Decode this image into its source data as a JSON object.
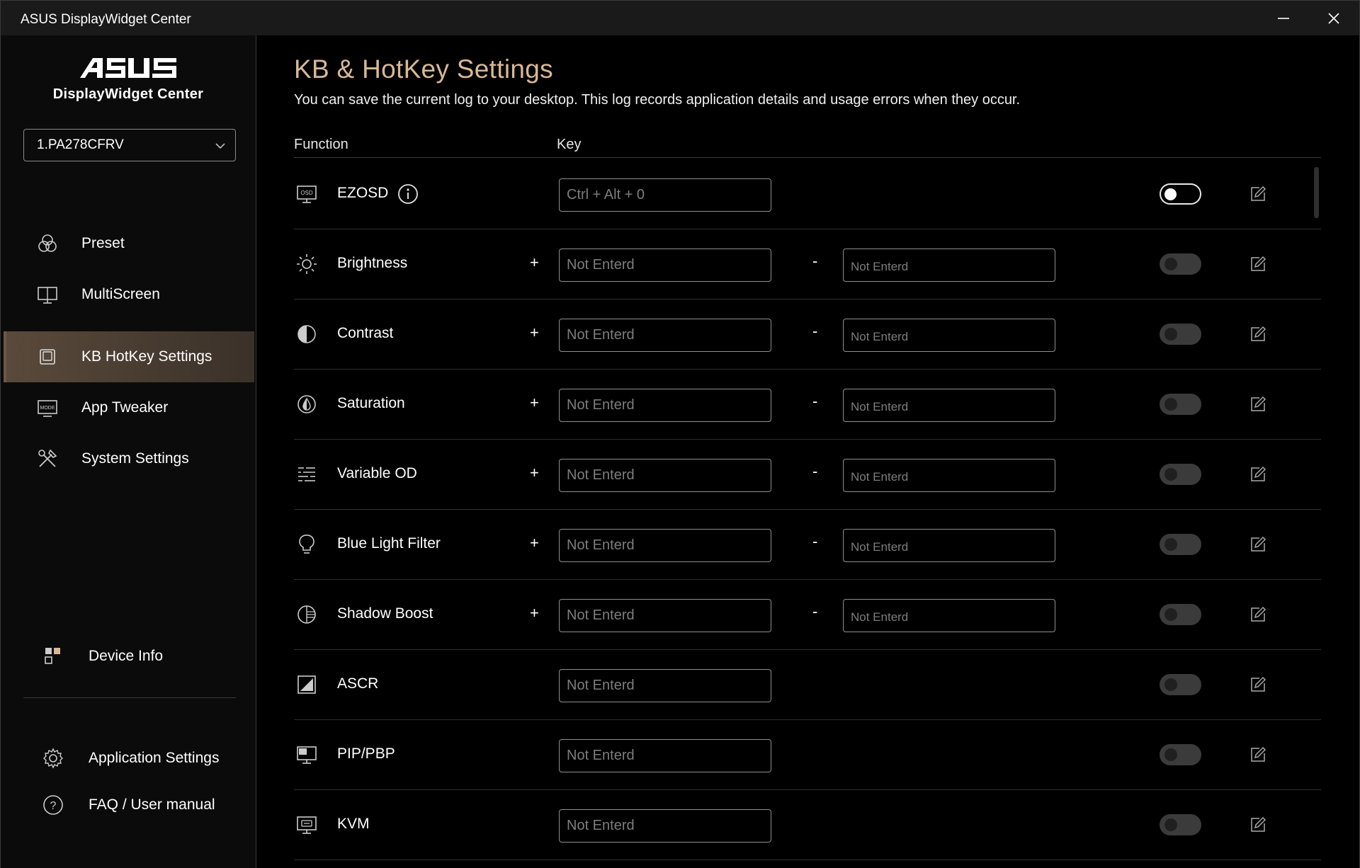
{
  "window": {
    "title": "ASUS DisplayWidget Center",
    "minimize_icon": "minimize-icon",
    "close_icon": "close-icon"
  },
  "sidebar": {
    "brand_logo": "ASUS",
    "brand_subtitle": "DisplayWidget Center",
    "device_select": {
      "value": "1.PA278CFRV"
    },
    "nav": [
      {
        "label": "Preset",
        "icon": "preset-icon",
        "active": false
      },
      {
        "label": "MultiScreen",
        "icon": "multiscreen-icon",
        "active": false
      },
      {
        "label": "KB HotKey Settings",
        "icon": "kb-hotkey-icon",
        "active": true
      },
      {
        "label": "App Tweaker",
        "icon": "app-tweaker-icon",
        "active": false
      },
      {
        "label": "System Settings",
        "icon": "system-settings-icon",
        "active": false
      }
    ],
    "device_info": "Device Info",
    "app_settings": "Application Settings",
    "faq": "FAQ / User manual"
  },
  "main": {
    "title": "KB & HotKey Settings",
    "description": "You can save the current log to your desktop. This log records application details and usage errors when they occur.",
    "columns": {
      "function": "Function",
      "key": "Key"
    },
    "plus_sign": "+",
    "minus_sign": "-",
    "rows": [
      {
        "label": "EZOSD",
        "icon": "osd-icon",
        "key_placeholder": "Ctrl + Alt + 0",
        "enabled": true,
        "has_info": true
      },
      {
        "label": "Brightness",
        "icon": "brightness-icon",
        "key_placeholder": "Not Enterd",
        "minus_placeholder": "Not Enterd",
        "enabled": false
      },
      {
        "label": "Contrast",
        "icon": "contrast-icon",
        "key_placeholder": "Not Enterd",
        "minus_placeholder": "Not Enterd",
        "enabled": false
      },
      {
        "label": "Saturation",
        "icon": "saturation-icon",
        "key_placeholder": "Not Enterd",
        "minus_placeholder": "Not Enterd",
        "enabled": false
      },
      {
        "label": "Variable OD",
        "icon": "variable-od-icon",
        "key_placeholder": "Not Enterd",
        "minus_placeholder": "Not Enterd",
        "enabled": false
      },
      {
        "label": "Blue Light Filter",
        "icon": "blue-light-filter-icon",
        "key_placeholder": "Not Enterd",
        "minus_placeholder": "Not Enterd",
        "enabled": false
      },
      {
        "label": "Shadow Boost",
        "icon": "shadow-boost-icon",
        "key_placeholder": "Not Enterd",
        "minus_placeholder": "Not Enterd",
        "enabled": false
      },
      {
        "label": "ASCR",
        "icon": "ascr-icon",
        "key_placeholder": "Not Enterd",
        "enabled": false
      },
      {
        "label": "PIP/PBP",
        "icon": "pip-pbp-icon",
        "key_placeholder": "Not Enterd",
        "enabled": false
      },
      {
        "label": "KVM",
        "icon": "kvm-icon",
        "key_placeholder": "Not Enterd",
        "enabled": false
      }
    ]
  },
  "colors": {
    "accent_title": "#d8b896",
    "active_nav": "#5a4a3b",
    "background": "#000000"
  }
}
